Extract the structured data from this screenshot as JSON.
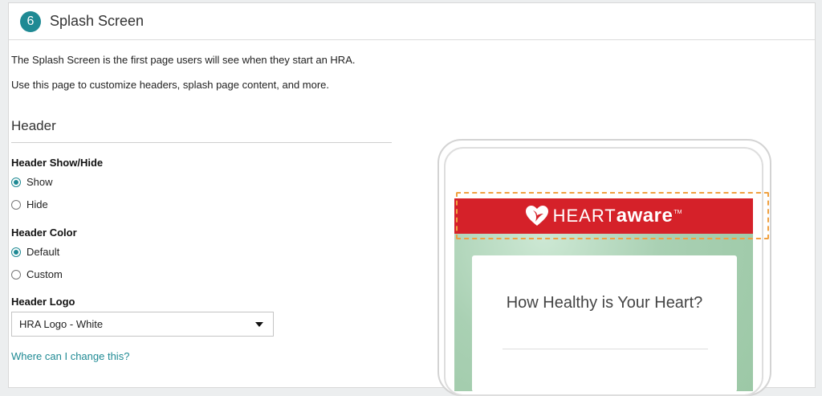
{
  "panel": {
    "step_number": "6",
    "title": "Splash Screen"
  },
  "intro": {
    "line1": "The Splash Screen is the first page users will see when they start an HRA.",
    "line2": "Use this page to customize headers, splash page content, and more."
  },
  "header_section": {
    "title": "Header",
    "show_hide": {
      "label": "Header Show/Hide",
      "options": [
        "Show",
        "Hide"
      ],
      "selected": "Show"
    },
    "color": {
      "label": "Header Color",
      "options": [
        "Default",
        "Custom"
      ],
      "selected": "Default"
    },
    "logo": {
      "label": "Header Logo",
      "selected_value": "HRA Logo - White"
    },
    "help_link": "Where can I change this?"
  },
  "preview": {
    "logo_light": "HEART",
    "logo_bold": "aware",
    "logo_tm": "TM",
    "card_title": "How Healthy is Your Heart?",
    "header_color": "#d52129",
    "highlight_color": "#f0a040"
  },
  "colors": {
    "accent": "#1f8a94"
  }
}
